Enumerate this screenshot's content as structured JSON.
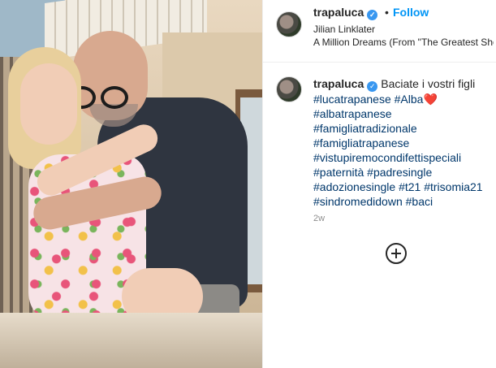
{
  "header": {
    "username": "trapaluca",
    "separator": "•",
    "follow_label": "Follow",
    "artist": "Jilian Linklater",
    "song": "A Million Dreams (From \"The Greatest Showman\")"
  },
  "caption": {
    "username": "trapaluca",
    "message": "Baciate i vostri figli",
    "lines": [
      "#lucatrapanese #Alba",
      "#albatrapanese",
      "#famigliatradizionale",
      "#famigliatrapanese",
      "#vistupiremocondifettispeciali",
      "#paternità #padresingle",
      "#adozionesingle #t21 #trisomia21",
      "#sindromedidown #baci"
    ],
    "heart": "❤️",
    "age": "2w"
  },
  "icons": {
    "verified": "verified-badge-icon",
    "add": "add-circle-icon"
  },
  "colors": {
    "link_blue": "#0095f6",
    "hashtag": "#00376b",
    "verified": "#3897f0"
  }
}
